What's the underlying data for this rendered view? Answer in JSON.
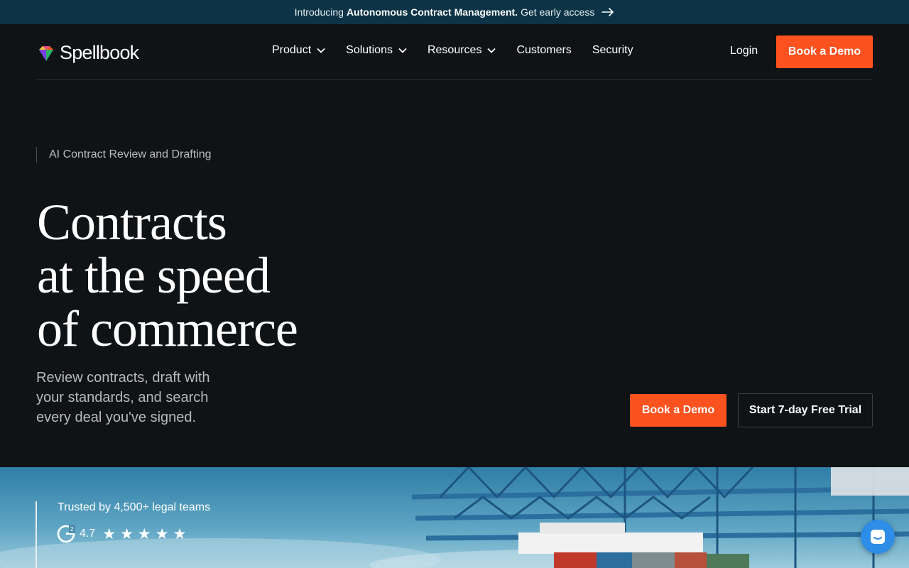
{
  "announcement": {
    "prefix": "Introducing",
    "highlight": "Autonomous Contract Management.",
    "cta": "Get early access"
  },
  "nav": {
    "brand": "Spellbook",
    "items": [
      {
        "label": "Product",
        "has_dropdown": true
      },
      {
        "label": "Solutions",
        "has_dropdown": true
      },
      {
        "label": "Resources",
        "has_dropdown": true
      },
      {
        "label": "Customers",
        "has_dropdown": false
      },
      {
        "label": "Security",
        "has_dropdown": false
      }
    ],
    "login": "Login",
    "demo_button": "Book a Demo"
  },
  "hero": {
    "eyebrow": "AI Contract Review and Drafting",
    "headline_lines": [
      "Contracts",
      "at the speed",
      "of commerce"
    ],
    "subheadline": "Review contracts, draft with your standards, and search every deal you've signed.",
    "primary_cta": "Book a Demo",
    "secondary_cta": "Start 7-day Free Trial"
  },
  "trust": {
    "title": "Trusted by 4,500+ legal teams",
    "rating": "4.7",
    "stars": 5
  },
  "colors": {
    "background": "#101316",
    "announcement_bar": "#0c3346",
    "accent": "#fc5220",
    "chat_button": "#2e8de6"
  },
  "icons": [
    "gem-logo-icon",
    "arrow-right-icon",
    "chevron-down-icon",
    "g2-logo-icon",
    "star-icon",
    "chat-icon"
  ]
}
